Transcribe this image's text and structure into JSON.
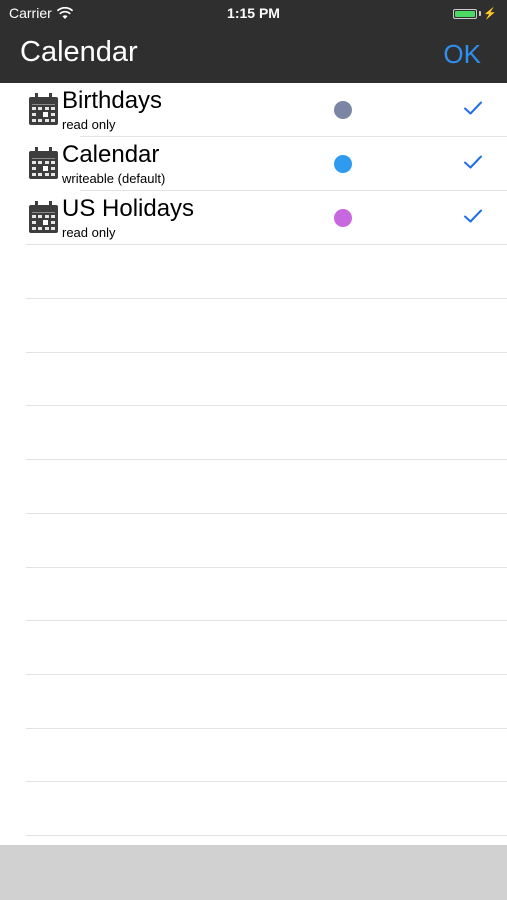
{
  "status_bar": {
    "carrier": "Carrier",
    "time": "1:15 PM",
    "battery_level": 1.0,
    "battery_color": "#4cd964"
  },
  "nav": {
    "title": "Calendar",
    "ok_label": "OK",
    "ok_color": "#2f8ef0",
    "bar_color": "#2f2f2f"
  },
  "calendars": [
    {
      "name": "Birthdays",
      "subtitle": "read only",
      "color": "#7b86a4",
      "checked": true,
      "icon": "calendar-icon"
    },
    {
      "name": "Calendar",
      "subtitle": "writeable (default)",
      "color": "#2e9bf0",
      "checked": true,
      "icon": "calendar-icon"
    },
    {
      "name": "US Holidays",
      "subtitle": "read only",
      "color": "#c868e0",
      "checked": true,
      "icon": "calendar-icon"
    }
  ],
  "checkmark_color": "#1f6fe8",
  "bottom_bar_color": "#d1d1d1"
}
